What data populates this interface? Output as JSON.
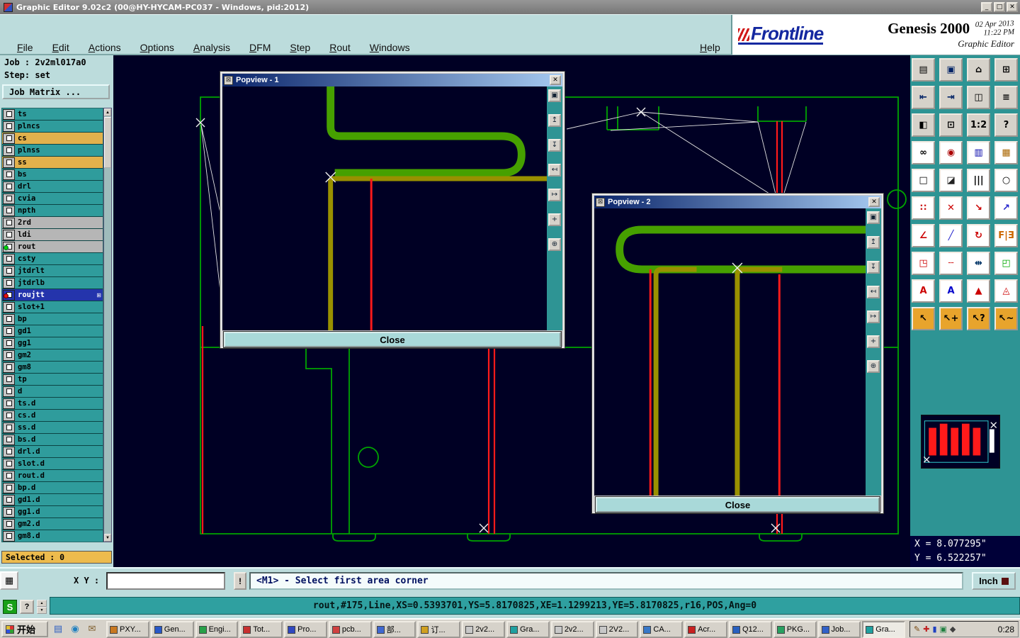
{
  "colors": {
    "chrome": "#bcdcdc",
    "titlegray": "#868686",
    "canvasbg": "#000024",
    "panel": "#2e9494",
    "boardgreen": "#00a400",
    "tracegreen": "#46a000",
    "oliv": "#999000",
    "tred": "#ff1a1a",
    "rowteal": "#2f9c9c",
    "rowgold": "#e2b14c",
    "rowgray": "#b6b6b6",
    "rowsel": "#2434ac",
    "goldbar": "#edbb4d",
    "face": "#d6d2ca",
    "pb1": "#0a246a",
    "pb2": "#a6caf0",
    "cmdteal": "#2fa0a0",
    "coordsbg": "#000038"
  },
  "titlebar": {
    "title": "Graphic Editor 9.02c2 (00@HY-HYCAM-PC037 - Windows, pid:2012)"
  },
  "window_controls": {
    "minimize": "_",
    "maximize": "□",
    "close": "✕"
  },
  "menu_items": [
    "File",
    "Edit",
    "Actions",
    "Options",
    "Analysis",
    "DFM",
    "Step",
    "Rout",
    "Windows"
  ],
  "help_label": "Help",
  "brand": {
    "name": "Frontline",
    "product": "Genesis 2000",
    "date": "02 Apr 2013",
    "time": "11:22 PM",
    "subtitle": "Graphic Editor"
  },
  "job": {
    "job_label": "Job : ",
    "job_value": "2v2ml017a0",
    "step_label": "Step: ",
    "step_value": "set",
    "matrix_label": "Job Matrix ..."
  },
  "layers": [
    {
      "name": "ts",
      "cls": "teal"
    },
    {
      "name": "plncs",
      "cls": "teal"
    },
    {
      "name": "cs",
      "cls": "gold"
    },
    {
      "name": "plnss",
      "cls": "teal"
    },
    {
      "name": "ss",
      "cls": "gold"
    },
    {
      "name": "bs",
      "cls": "teal"
    },
    {
      "name": "drl",
      "cls": "teal"
    },
    {
      "name": "cvia",
      "cls": "teal"
    },
    {
      "name": "npth",
      "cls": "teal"
    },
    {
      "name": "2rd",
      "cls": "gray"
    },
    {
      "name": "ldi",
      "cls": "gray"
    },
    {
      "name": "rout",
      "cls": "gray",
      "ind": "green"
    },
    {
      "name": "csty",
      "cls": "teal"
    },
    {
      "name": "jtdrlt",
      "cls": "teal"
    },
    {
      "name": "jtdrlb",
      "cls": "teal"
    },
    {
      "name": "roujtt",
      "cls": "sel",
      "ind": "red",
      "badge": "⊞"
    },
    {
      "name": "slot+1",
      "cls": "teal"
    },
    {
      "name": "bp",
      "cls": "teal"
    },
    {
      "name": "gd1",
      "cls": "teal"
    },
    {
      "name": "gg1",
      "cls": "teal"
    },
    {
      "name": "gm2",
      "cls": "teal"
    },
    {
      "name": "gm8",
      "cls": "teal"
    },
    {
      "name": "tp",
      "cls": "teal"
    },
    {
      "name": "d",
      "cls": "teal"
    },
    {
      "name": "ts.d",
      "cls": "teal"
    },
    {
      "name": "cs.d",
      "cls": "teal"
    },
    {
      "name": "ss.d",
      "cls": "teal"
    },
    {
      "name": "bs.d",
      "cls": "teal"
    },
    {
      "name": "drl.d",
      "cls": "teal"
    },
    {
      "name": "slot.d",
      "cls": "teal"
    },
    {
      "name": "rout.d",
      "cls": "teal"
    },
    {
      "name": "bp.d",
      "cls": "teal"
    },
    {
      "name": "gd1.d",
      "cls": "teal"
    },
    {
      "name": "gg1.d",
      "cls": "teal"
    },
    {
      "name": "gm2.d",
      "cls": "teal"
    },
    {
      "name": "gm8.d",
      "cls": "teal"
    }
  ],
  "selected_label": "Selected : 0",
  "popview1": {
    "title": "Popview - 1",
    "close_label": "Close"
  },
  "popview2": {
    "title": "Popview - 2",
    "close_label": "Close"
  },
  "popview_tools": [
    {
      "icon": "popview-detach-icon",
      "glyph": "▣"
    },
    {
      "icon": "popview-pan-up-icon",
      "glyph": "↥"
    },
    {
      "icon": "popview-pan-down-icon",
      "glyph": "↧"
    },
    {
      "icon": "popview-pan-left-icon",
      "glyph": "↤"
    },
    {
      "icon": "popview-pan-right-icon",
      "glyph": "↦"
    },
    {
      "icon": "popview-zoom-all-icon",
      "glyph": "+"
    },
    {
      "icon": "popview-center-icon",
      "glyph": "⊕"
    }
  ],
  "toolbar": [
    {
      "icon": "clipboard-icon",
      "glyph": "▤",
      "fg": "#000000",
      "bg": "#d6d2ca"
    },
    {
      "icon": "screen-capture-icon",
      "glyph": "▣",
      "fg": "#002266",
      "bg": "#d6d2ca"
    },
    {
      "icon": "home-view-icon",
      "glyph": "⌂",
      "fg": "#000000",
      "bg": "#d6d2ca"
    },
    {
      "icon": "tile-view-icon",
      "glyph": "⊞",
      "fg": "#000000",
      "bg": "#d6d2ca"
    },
    {
      "icon": "zoom-prev-icon",
      "glyph": "⇤",
      "fg": "#002266",
      "bg": "#d6d2ca"
    },
    {
      "icon": "zoom-next-icon",
      "glyph": "⇥",
      "fg": "#002266",
      "bg": "#d6d2ca"
    },
    {
      "icon": "split-view-icon",
      "glyph": "◫",
      "fg": "#000000",
      "bg": "#d6d2ca"
    },
    {
      "icon": "layer-list-icon",
      "glyph": "≡",
      "fg": "#000000",
      "bg": "#d6d2ca"
    },
    {
      "icon": "clone-view-icon",
      "glyph": "◧",
      "fg": "#000000",
      "bg": "#d6d2ca"
    },
    {
      "icon": "fit-screen-icon",
      "glyph": "⊡",
      "fg": "#000000",
      "bg": "#d6d2ca"
    },
    {
      "icon": "scale-1-2-icon",
      "glyph": "1:2",
      "fg": "#000000",
      "bg": "#d6d2ca"
    },
    {
      "icon": "help-tool-icon",
      "glyph": "?",
      "fg": "#000000",
      "bg": "#d6d2ca"
    },
    {
      "icon": "view-filter-icon",
      "glyph": "∞",
      "fg": "#000000",
      "bg": "#ffffff"
    },
    {
      "icon": "snap-dot-icon",
      "glyph": "◉",
      "fg": "#aa0000",
      "bg": "#ffffff"
    },
    {
      "icon": "color-table-icon",
      "glyph": "▥",
      "fg": "#0000aa",
      "bg": "#ffffff"
    },
    {
      "icon": "color-table-2-icon",
      "glyph": "▦",
      "fg": "#aa6600",
      "bg": "#ffffff"
    },
    {
      "icon": "frame-icon",
      "glyph": "□",
      "fg": "#000000",
      "bg": "#ffffff"
    },
    {
      "icon": "shear-icon",
      "glyph": "◪",
      "fg": "#222222",
      "bg": "#ffffff"
    },
    {
      "icon": "comb-icon",
      "glyph": "|||",
      "fg": "#000000",
      "bg": "#ffffff"
    },
    {
      "icon": "pad-icon",
      "glyph": "○",
      "fg": "#000000",
      "bg": "#ffffff"
    },
    {
      "icon": "cluster-icon",
      "glyph": "∷",
      "fg": "#cc2222",
      "bg": "#ffffff"
    },
    {
      "icon": "erase-icon",
      "glyph": "✕",
      "fg": "#cc0000",
      "bg": "#ffffff"
    },
    {
      "icon": "vertex-move-icon",
      "glyph": "↘",
      "fg": "#cc0000",
      "bg": "#ffffff"
    },
    {
      "icon": "vertex-copy-icon",
      "glyph": "↗",
      "fg": "#2222cc",
      "bg": "#ffffff"
    },
    {
      "icon": "angle-tool-icon",
      "glyph": "∠",
      "fg": "#cc0000",
      "bg": "#ffffff"
    },
    {
      "icon": "slope-tool-icon",
      "glyph": "╱",
      "fg": "#2222cc",
      "bg": "#ffffff"
    },
    {
      "icon": "rotate-tool-icon",
      "glyph": "↻",
      "fg": "#cc0000",
      "bg": "#ffffff"
    },
    {
      "icon": "mirror-tool-icon",
      "glyph": "F|Ǝ",
      "fg": "#cc6600",
      "bg": "#ffffff"
    },
    {
      "icon": "pad-corner-icon",
      "glyph": "◳",
      "fg": "#cc0000",
      "bg": "#ffffff"
    },
    {
      "icon": "dashed-line-icon",
      "glyph": "┄",
      "fg": "#cc0000",
      "bg": "#ffffff"
    },
    {
      "icon": "stretch-tool-icon",
      "glyph": "⇹",
      "fg": "#003366",
      "bg": "#ffffff"
    },
    {
      "icon": "reshape-tool-icon",
      "glyph": "◰",
      "fg": "#00aa00",
      "bg": "#ffffff"
    },
    {
      "icon": "text-outline-icon",
      "glyph": "A",
      "fg": "#cc0000",
      "bg": "#ffffff"
    },
    {
      "icon": "text-slant-icon",
      "glyph": "A",
      "fg": "#0000cc",
      "bg": "#ffffff"
    },
    {
      "icon": "text-filled-icon",
      "glyph": "▲",
      "fg": "#cc0000",
      "bg": "#ffffff"
    },
    {
      "icon": "text-grid-icon",
      "glyph": "◬",
      "fg": "#cc0000",
      "bg": "#ffffff"
    },
    {
      "icon": "cursor-select-icon",
      "glyph": "↖",
      "fg": "#000000",
      "bg": "#e8a42c"
    },
    {
      "icon": "cursor-select-plus-icon",
      "glyph": "↖+",
      "fg": "#000000",
      "bg": "#e8a42c"
    },
    {
      "icon": "cursor-query-icon",
      "glyph": "↖?",
      "fg": "#000000",
      "bg": "#e8a42c"
    },
    {
      "icon": "cursor-snap-icon",
      "glyph": "↖~",
      "fg": "#000000",
      "bg": "#e8a42c"
    }
  ],
  "left_tools": [
    {
      "icon": "draw-line-mode-icon",
      "glyph": "╲"
    },
    {
      "icon": "measure-mode-icon",
      "glyph": "∠"
    },
    {
      "icon": "grid-toggle-icon",
      "glyph": "▦"
    }
  ],
  "bottombar": {
    "xy_label": "X Y :",
    "input_value": "",
    "alert_glyph": "!",
    "prompt": "<M1> - Select first area corner",
    "unit_label": "Inch"
  },
  "coords": {
    "x": "X = 8.077295\"",
    "y": "Y = 6.522257\""
  },
  "command_line": "rout,#175,Line,XS=0.5393701,YS=5.8170825,XE=1.1299213,YE=5.8170825,r16,POS,Ang=0",
  "misc": {
    "ime_label": "S",
    "help_button": "?",
    "spinner_up": "▲",
    "spinner_down": "▼"
  },
  "taskbar": {
    "start_label": "开始",
    "quick_launch": [
      {
        "icon": "quick-desktop-icon",
        "glyph": "▤",
        "color": "#3060c0"
      },
      {
        "icon": "quick-browser-icon",
        "glyph": "◉",
        "color": "#2080c0"
      },
      {
        "icon": "quick-mail-icon",
        "glyph": "✉",
        "color": "#806030"
      }
    ],
    "tasks": [
      {
        "label": "PXY...",
        "color": "#c87820"
      },
      {
        "label": "Gen...",
        "color": "#2858c8"
      },
      {
        "label": "Engi...",
        "color": "#28a048"
      },
      {
        "label": "Tot...",
        "color": "#c83030"
      },
      {
        "label": "Pro...",
        "color": "#3048c0"
      },
      {
        "label": "pcb...",
        "color": "#d04040"
      },
      {
        "label": "部...",
        "color": "#4068d0"
      },
      {
        "label": "订...",
        "color": "#d0a020"
      },
      {
        "label": "2v2...",
        "color": "#c8c8c8"
      },
      {
        "label": "Gra...",
        "color": "#20a0a0"
      },
      {
        "label": "2v2...",
        "color": "#c8c8c8"
      },
      {
        "label": "2V2...",
        "color": "#c8c8c8"
      },
      {
        "label": "CA...",
        "color": "#3878c8"
      },
      {
        "label": "Acr...",
        "color": "#c82020"
      },
      {
        "label": "Q12...",
        "color": "#2860c0"
      },
      {
        "label": "PKG...",
        "color": "#28a060"
      },
      {
        "label": "Job...",
        "color": "#3060c8"
      },
      {
        "label": "Gra...",
        "color": "#20a0a0",
        "cls": "active"
      }
    ],
    "tray_icons": [
      {
        "icon": "tray-pen-icon",
        "glyph": "✎",
        "color": "#7a4a10"
      },
      {
        "icon": "tray-antivirus-icon",
        "glyph": "✚",
        "color": "#c02020"
      },
      {
        "icon": "tray-network-icon",
        "glyph": "▮",
        "color": "#2040c0"
      },
      {
        "icon": "tray-display-icon",
        "glyph": "▣",
        "color": "#208040"
      },
      {
        "icon": "tray-volume-icon",
        "glyph": "◆",
        "color": "#404040"
      }
    ],
    "time": "0:28"
  }
}
